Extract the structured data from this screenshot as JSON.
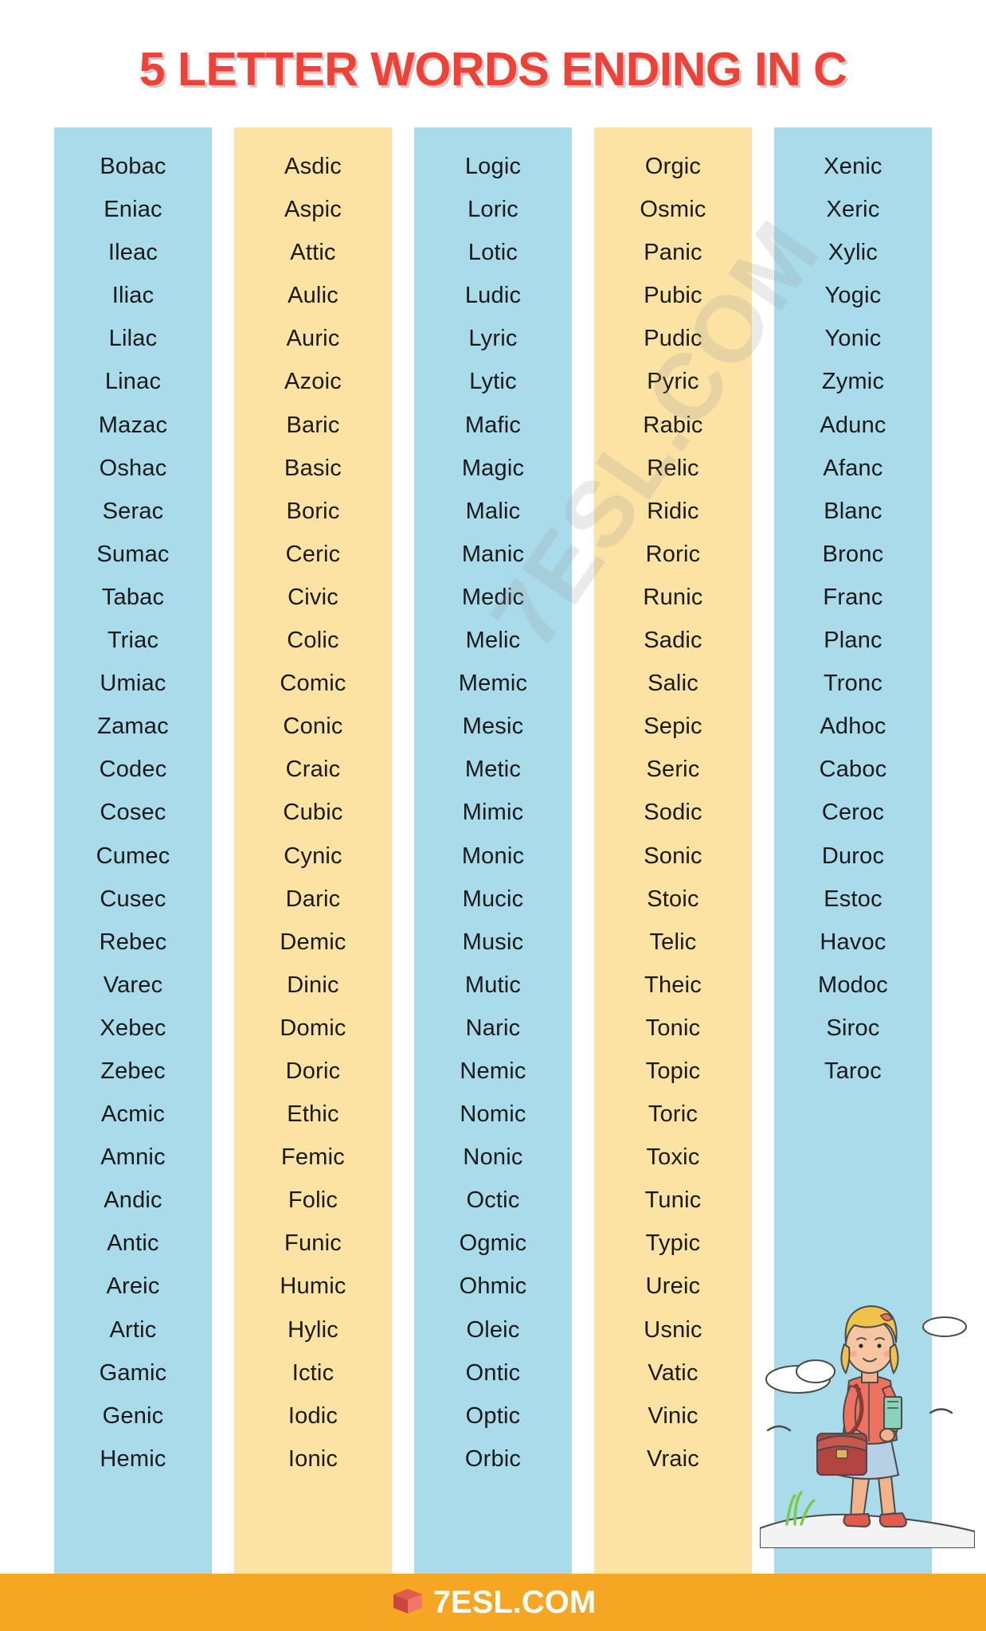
{
  "title": "5 LETTER WORDS ENDING IN C",
  "brand": {
    "footer_text": "7ESL.COM",
    "watermark": "7ESL.COM",
    "footer_bg": "#f5a623",
    "title_color": "#ef4136"
  },
  "palette": {
    "blue": "#a9dbeb",
    "yellow": "#fce3a4",
    "word_color": "#1a1a1a"
  },
  "columns": [
    {
      "color": "blue",
      "words": [
        "Bobac",
        "Eniac",
        "Ileac",
        "Iliac",
        "Lilac",
        "Linac",
        "Mazac",
        "Oshac",
        "Serac",
        "Sumac",
        "Tabac",
        "Triac",
        "Umiac",
        "Zamac",
        "Codec",
        "Cosec",
        "Cumec",
        "Cusec",
        "Rebec",
        "Varec",
        "Xebec",
        "Zebec",
        "Acmic",
        "Amnic",
        "Andic",
        "Antic",
        "Areic",
        "Artic",
        "Gamic",
        "Genic",
        "Hemic"
      ]
    },
    {
      "color": "yellow",
      "words": [
        "Asdic",
        "Aspic",
        "Attic",
        "Aulic",
        "Auric",
        "Azoic",
        "Baric",
        "Basic",
        "Boric",
        "Ceric",
        "Civic",
        "Colic",
        "Comic",
        "Conic",
        "Craic",
        "Cubic",
        "Cynic",
        "Daric",
        "Demic",
        "Dinic",
        "Domic",
        "Doric",
        "Ethic",
        "Femic",
        "Folic",
        "Funic",
        "Humic",
        "Hylic",
        "Ictic",
        "Iodic",
        "Ionic"
      ]
    },
    {
      "color": "blue",
      "words": [
        "Logic",
        "Loric",
        "Lotic",
        "Ludic",
        "Lyric",
        "Lytic",
        "Mafic",
        "Magic",
        "Malic",
        "Manic",
        "Medic",
        "Melic",
        "Memic",
        "Mesic",
        "Metic",
        "Mimic",
        "Monic",
        "Mucic",
        "Music",
        "Mutic",
        "Naric",
        "Nemic",
        "Nomic",
        "Nonic",
        "Octic",
        "Ogmic",
        "Ohmic",
        "Oleic",
        "Ontic",
        "Optic",
        "Orbic"
      ]
    },
    {
      "color": "yellow",
      "words": [
        "Orgic",
        "Osmic",
        "Panic",
        "Pubic",
        "Pudic",
        "Pyric",
        "Rabic",
        "Relic",
        "Ridic",
        "Roric",
        "Runic",
        "Sadic",
        "Salic",
        "Sepic",
        "Seric",
        "Sodic",
        "Sonic",
        "Stoic",
        "Telic",
        "Theic",
        "Tonic",
        "Topic",
        "Toric",
        "Toxic",
        "Tunic",
        "Typic",
        "Ureic",
        "Usnic",
        "Vatic",
        "Vinic",
        "Vraic"
      ]
    },
    {
      "color": "blue",
      "words": [
        "Xenic",
        "Xeric",
        "Xylic",
        "Yogic",
        "Yonic",
        "Zymic",
        "Adunc",
        "Afanc",
        "Blanc",
        "Bronc",
        "Franc",
        "Planc",
        "Tronc",
        "Adhoc",
        "Caboc",
        "Ceroc",
        "Duroc",
        "Estoc",
        "Havoc",
        "Modoc",
        "Siroc",
        "Taroc"
      ]
    }
  ]
}
